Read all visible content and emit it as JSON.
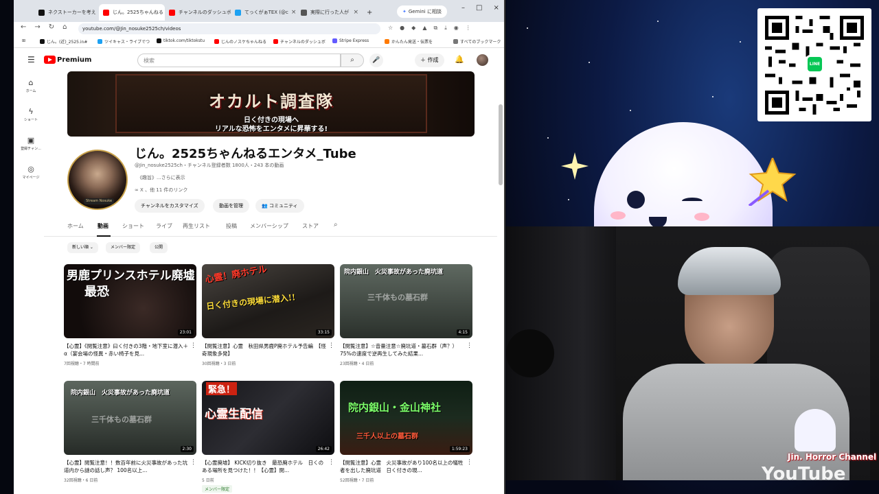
{
  "browser": {
    "tabs": [
      {
        "label": "ネクストーカーを考え",
        "color": "#111111"
      },
      {
        "label": "じん。2525ちゃんねる",
        "color": "#ff0000"
      },
      {
        "label": "チャンネルのダッシュボ",
        "color": "#ff0000"
      },
      {
        "label": "てっくがぁTEX (@c",
        "color": "#1da1f2"
      },
      {
        "label": "実際に行った人が",
        "color": "#555555"
      }
    ],
    "new_tab": "+",
    "gemini_label": "Gemini に相談",
    "url": "youtube.com/@Jin_nosuke2525ch/videos",
    "bookmarks": [
      {
        "label": "じん。(近)_2525.in#",
        "color": "#111111"
      },
      {
        "label": "ツイキャス・ライブでつ",
        "color": "#1da1f2"
      },
      {
        "label": "tiktok.com/tiktokstu",
        "color": "#111111"
      },
      {
        "label": "じんのノスケちゃんねる",
        "color": "#ff0000"
      },
      {
        "label": "チャンネルのダッシュボ",
        "color": "#ff0000"
      },
      {
        "label": "Stripe Express",
        "color": "#635bff"
      },
      {
        "label": "かんたん発送・伝票を",
        "color": "#ff7a00"
      },
      {
        "label": "すべてのブックマーク",
        "color": "#777777"
      }
    ]
  },
  "youtube": {
    "logo": "Premium",
    "search_placeholder": "検索",
    "create_label": "作成",
    "sidebar": [
      "ホーム",
      "ショート",
      "登録チャン...",
      "マイページ"
    ],
    "banner": {
      "title": "オカルト調査隊",
      "sub1": "日く付きの現場へ",
      "sub2": "リアルな恐怖をエンタメに昇華する!"
    },
    "channel": {
      "avatar_ribbon": "Stream Nosuke",
      "name": "じん。2525ちゃんねるエンタメ_Tube",
      "meta": "@Jin_nosuke2525ch・チャンネル登録者数 1800人・243 本の動画",
      "description": "《趣旨》...さらに表示",
      "links": "∞ X 、他 11 件のリンク",
      "buttons": [
        "チャンネルをカスタマイズ",
        "動画を管理",
        "コミュニティ"
      ]
    },
    "tabs": [
      "ホーム",
      "動画",
      "ショート",
      "ライブ",
      "再生リスト",
      "投稿",
      "メンバーシップ",
      "ストア"
    ],
    "chips": [
      "新しい順 ⌄",
      "メンバー限定",
      "公開"
    ],
    "videos": [
      {
        "title": "【心霊】《閲覧注意》曰く付きの3階・地下室に潜入＋α（宴会場の怪異・赤い椅子を見...",
        "meta": "7回視聴・7 時間前",
        "duration": "23:01",
        "thumb_text": "男鹿プリンスホテル廃墟",
        "thumb_text2": "最恐"
      },
      {
        "title": "【閲覧注意】心霊　秋田県男鹿P廃ホテル予告編　【怪奇現象多発】",
        "meta": "30回視聴・3 日前",
        "duration": "33:15",
        "thumb_text": "心霊！廃ホテル",
        "thumb_text2": "日く付きの現場に潜入!!"
      },
      {
        "title": "【閲覧注意】☆音量注意☆廃坑道・墓石群（声？）75%の速度で逆再生してみた結果...",
        "meta": "23回視聴・4 日前",
        "duration": "4:15",
        "thumb_text": "院内銀山　火災事故があった廃坑道",
        "thumb_text2": "三千体もの墓石群"
      },
      {
        "title": "【心霊】閲覧注意！！数百年前に火災事故があった坑道内から謎の話し声？ 100名以上...",
        "meta": "32回視聴・6 日前",
        "duration": "2:30",
        "thumb_text": "院内銀山　火災事故があった廃坑道",
        "thumb_text2": "三千体もの墓石群"
      },
      {
        "title": "【心霊廃墟】 KICK切り抜き　最恐廃ホテル　日くのある場所を見つけた！！【心霊】閲...",
        "meta": "5 日前",
        "duration": "26:42",
        "thumb_text": "緊急！",
        "thumb_text2": "心霊生配信",
        "badge": "メンバー限定"
      },
      {
        "title": "【閲覧注意】心霊　火災事故があり100名以上の犠牲者を出した廃坑道　日く付きの現...",
        "meta": "52回視聴・7 日前",
        "duration": "1:59:23",
        "thumb_text": "院内銀山・金山神社",
        "thumb_text2": "三千人以上の墓石群"
      }
    ]
  },
  "stream": {
    "qr_badge": "LINE",
    "brand_logo": "Jin. Horror Channel",
    "watermark": "YouTube"
  }
}
